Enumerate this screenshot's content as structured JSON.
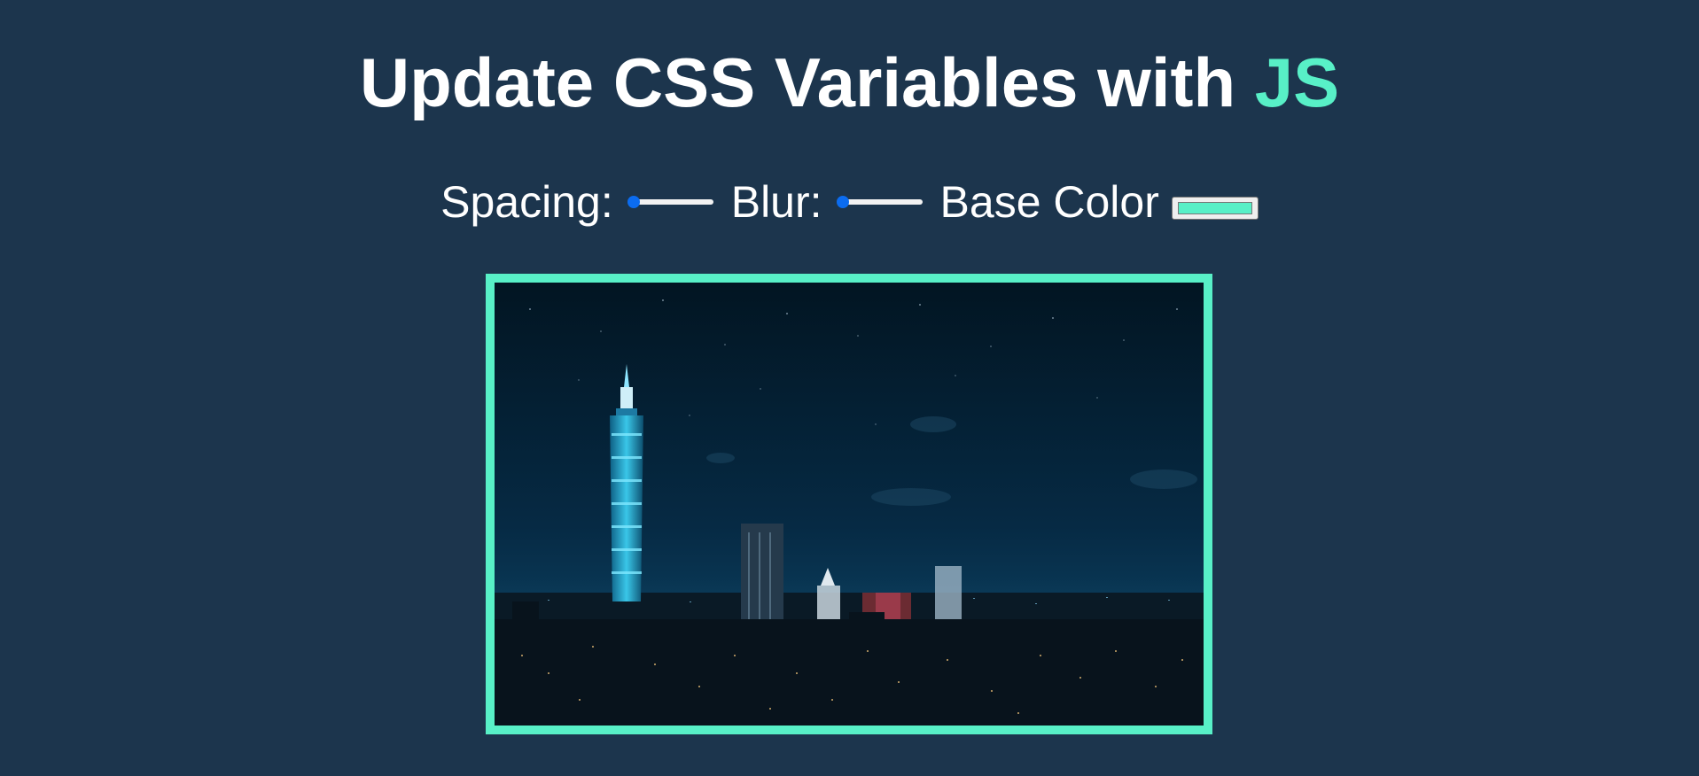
{
  "page": {
    "title_main": "Update CSS Variables with ",
    "title_accent": "JS"
  },
  "controls": {
    "spacing": {
      "label": "Spacing:",
      "value": 0,
      "min": 0,
      "max": 200
    },
    "blur": {
      "label": "Blur:",
      "value": 0,
      "min": 0,
      "max": 25
    },
    "base_color": {
      "label": "Base Color",
      "value": "#58f0c7"
    }
  },
  "colors": {
    "background": "#1c354d",
    "accent": "#58f0c7",
    "slider_thumb": "#0b6cf0"
  },
  "image": {
    "subject": "night-city-skyline-photo"
  }
}
